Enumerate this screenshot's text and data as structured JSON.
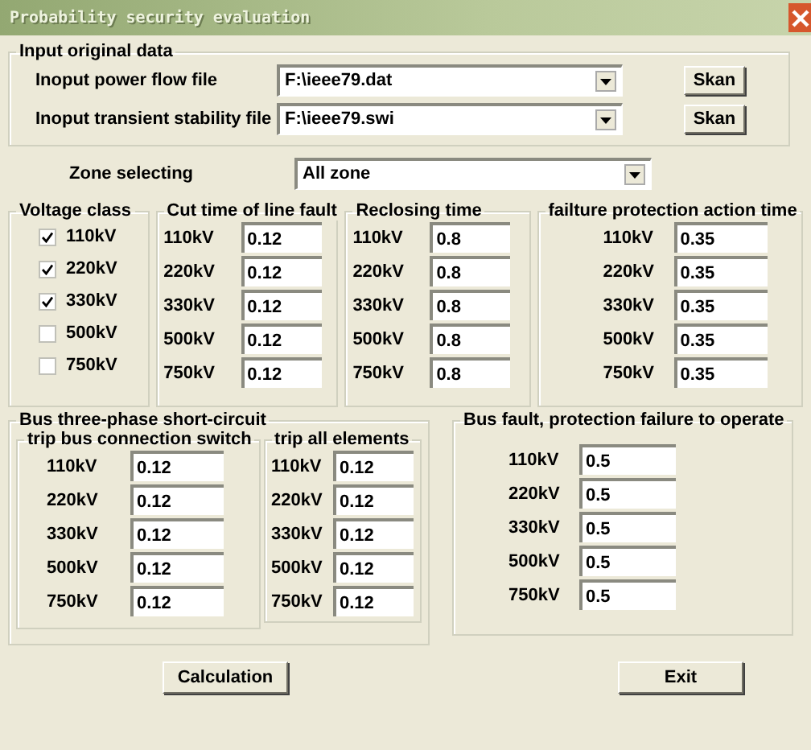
{
  "window": {
    "title": "Probability security evaluation"
  },
  "input_group": {
    "title": "Input original data",
    "files": [
      {
        "label": "Inoput power flow file",
        "value": "F:\\ieee79.dat",
        "button": "Skan"
      },
      {
        "label": "Inoput transient stability file",
        "value": "F:\\ieee79.swi",
        "button": "Skan"
      }
    ]
  },
  "zone": {
    "label": "Zone selecting",
    "value": "All zone"
  },
  "voltage_class": {
    "title": "Voltage class",
    "items": [
      {
        "label": "110kV",
        "checked": true
      },
      {
        "label": "220kV",
        "checked": true
      },
      {
        "label": "330kV",
        "checked": true
      },
      {
        "label": "500kV",
        "checked": false
      },
      {
        "label": "750kV",
        "checked": false
      }
    ]
  },
  "cut_time": {
    "title": "Cut time of line fault",
    "rows": [
      {
        "label": "110kV",
        "value": "0.12"
      },
      {
        "label": "220kV",
        "value": "0.12"
      },
      {
        "label": "330kV",
        "value": "0.12"
      },
      {
        "label": "500kV",
        "value": "0.12"
      },
      {
        "label": "750kV",
        "value": "0.12"
      }
    ]
  },
  "reclosing": {
    "title": "Reclosing time",
    "rows": [
      {
        "label": "110kV",
        "value": "0.8"
      },
      {
        "label": "220kV",
        "value": "0.8"
      },
      {
        "label": "330kV",
        "value": "0.8"
      },
      {
        "label": "500kV",
        "value": "0.8"
      },
      {
        "label": "750kV",
        "value": "0.8"
      }
    ]
  },
  "failure_protection": {
    "title": "failture  protection action time",
    "rows": [
      {
        "label": "110kV",
        "value": "0.35"
      },
      {
        "label": "220kV",
        "value": "0.35"
      },
      {
        "label": "330kV",
        "value": "0.35"
      },
      {
        "label": "500kV",
        "value": "0.35"
      },
      {
        "label": "750kV",
        "value": "0.35"
      }
    ]
  },
  "bus_short_circuit": {
    "title": "Bus three-phase short-circuit",
    "trip_bus": {
      "title": "trip bus connection switch",
      "rows": [
        {
          "label": "110kV",
          "value": "0.12"
        },
        {
          "label": "220kV",
          "value": "0.12"
        },
        {
          "label": "330kV",
          "value": "0.12"
        },
        {
          "label": "500kV",
          "value": "0.12"
        },
        {
          "label": "750kV",
          "value": "0.12"
        }
      ]
    },
    "trip_all": {
      "title": "trip all elements",
      "rows": [
        {
          "label": "110kV",
          "value": "0.12"
        },
        {
          "label": "220kV",
          "value": "0.12"
        },
        {
          "label": "330kV",
          "value": "0.12"
        },
        {
          "label": "500kV",
          "value": "0.12"
        },
        {
          "label": "750kV",
          "value": "0.12"
        }
      ]
    }
  },
  "bus_fault": {
    "title": "Bus fault,  protection failure to operate",
    "rows": [
      {
        "label": "110kV",
        "value": "0.5"
      },
      {
        "label": "220kV",
        "value": "0.5"
      },
      {
        "label": "330kV",
        "value": "0.5"
      },
      {
        "label": "500kV",
        "value": "0.5"
      },
      {
        "label": "750kV",
        "value": "0.5"
      }
    ]
  },
  "buttons": [
    "Calculation",
    "Exit"
  ]
}
